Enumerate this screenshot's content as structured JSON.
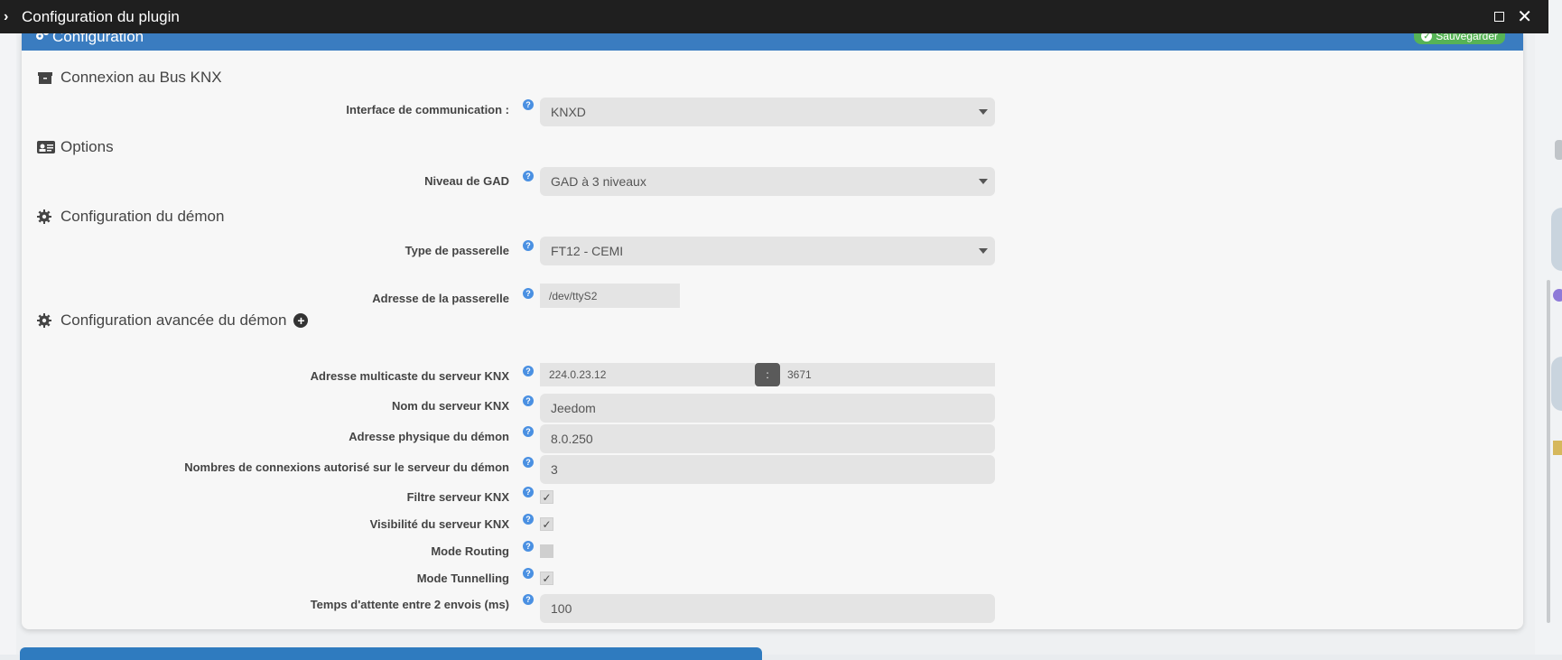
{
  "window": {
    "title": "Configuration du plugin"
  },
  "panel": {
    "title": "Configuration",
    "save_label": "Sauvegarder"
  },
  "sections": {
    "bus": "Connexion au Bus KNX",
    "options": "Options",
    "daemon": "Configuration du démon",
    "advanced": "Configuration avancée du démon"
  },
  "fields": {
    "interface": {
      "label": "Interface de communication :",
      "value": "KNXD"
    },
    "gad_level": {
      "label": "Niveau de GAD",
      "value": "GAD à 3 niveaux"
    },
    "gateway_type": {
      "label": "Type de passerelle",
      "value": "FT12 - CEMI"
    },
    "gateway_address": {
      "label": "Adresse de la passerelle",
      "value": "/dev/ttyS2"
    },
    "multicast": {
      "label": "Adresse multicaste du serveur KNX",
      "ip": "224.0.23.12",
      "separator": ":",
      "port": "3671"
    },
    "server_name": {
      "label": "Nom du serveur KNX",
      "value": "Jeedom"
    },
    "physical_address": {
      "label": "Adresse physique du démon",
      "value": "8.0.250"
    },
    "connections": {
      "label": "Nombres de connexions autorisé sur le serveur du démon",
      "value": "3"
    },
    "server_filter": {
      "label": "Filtre serveur KNX",
      "checked": true
    },
    "server_visibility": {
      "label": "Visibilité du serveur KNX",
      "checked": true
    },
    "routing_mode": {
      "label": "Mode Routing",
      "checked": false
    },
    "tunnelling_mode": {
      "label": "Mode Tunnelling",
      "checked": true
    },
    "wait_time": {
      "label": "Temps d'attente entre 2 envois (ms)",
      "value": "100"
    }
  },
  "colors": {
    "panel_header": "#3a7cc0",
    "save_button": "#56b356",
    "help_icon": "#4a90e2",
    "titlebar": "#1f1f1f"
  },
  "help_glyph": "?",
  "check_glyph": "✓",
  "plus_glyph": "+"
}
